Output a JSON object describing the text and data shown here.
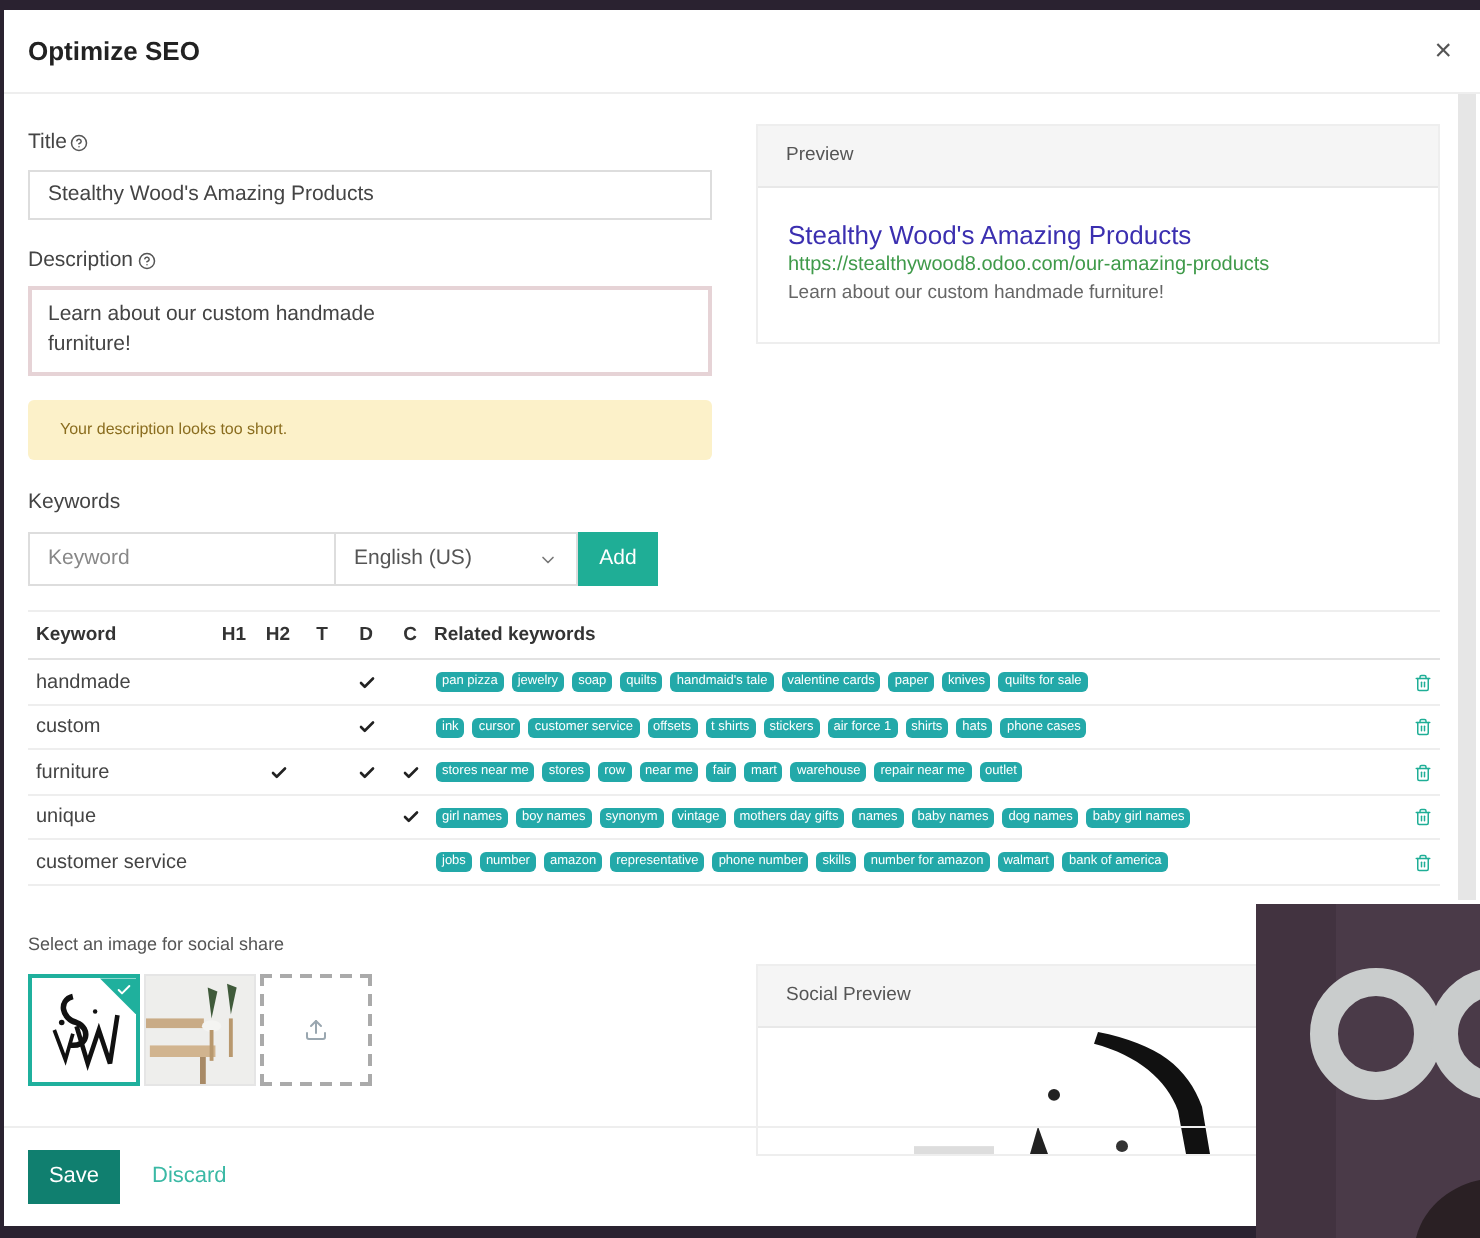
{
  "dialog": {
    "title": "Optimize SEO",
    "close": "×"
  },
  "title_field": {
    "label": "Title",
    "value": "Stealthy Wood's Amazing Products"
  },
  "description_field": {
    "label": "Description",
    "value": "Learn about our custom handmade\nfurniture!"
  },
  "alert": "Your description looks too short.",
  "keywords": {
    "label": "Keywords",
    "placeholder": "Keyword",
    "language": "English (US)",
    "add": "Add"
  },
  "preview": {
    "header": "Preview",
    "title": "Stealthy Wood's Amazing Products",
    "url": "https://stealthywood8.odoo.com/our-amazing-products",
    "description": "Learn about our custom handmade furniture!"
  },
  "table": {
    "columns": [
      "Keyword",
      "H1",
      "H2",
      "T",
      "D",
      "C",
      "Related keywords"
    ],
    "rows": [
      {
        "keyword": "handmade",
        "checks": [
          false,
          false,
          false,
          true,
          false
        ],
        "related": [
          "pan pizza",
          "jewelry",
          "soap",
          "quilts",
          "handmaid's tale",
          "valentine cards",
          "paper",
          "knives",
          "quilts for sale"
        ]
      },
      {
        "keyword": "custom",
        "checks": [
          false,
          false,
          false,
          true,
          false
        ],
        "related": [
          "ink",
          "cursor",
          "customer service",
          "offsets",
          "t shirts",
          "stickers",
          "air force 1",
          "shirts",
          "hats",
          "phone cases"
        ]
      },
      {
        "keyword": "furniture",
        "checks": [
          false,
          true,
          false,
          true,
          true
        ],
        "related": [
          "stores near me",
          "stores",
          "row",
          "near me",
          "fair",
          "mart",
          "warehouse",
          "repair near me",
          "outlet"
        ]
      },
      {
        "keyword": "unique",
        "checks": [
          false,
          false,
          false,
          false,
          true
        ],
        "related": [
          "girl names",
          "boy names",
          "synonym",
          "vintage",
          "mothers day gifts",
          "names",
          "baby names",
          "dog names",
          "baby girl names"
        ]
      },
      {
        "keyword": "customer service",
        "checks": [
          false,
          false,
          false,
          false,
          false
        ],
        "related": [
          "jobs",
          "number",
          "amazon",
          "representative",
          "phone number",
          "skills",
          "number for amazon",
          "walmart",
          "bank of america"
        ]
      }
    ]
  },
  "social": {
    "label": "Select an image for social share",
    "images": [
      {
        "kind": "logo",
        "selected": true
      },
      {
        "kind": "picture",
        "selected": false
      },
      {
        "kind": "upload",
        "selected": false
      }
    ],
    "preview_header": "Social Preview"
  },
  "footer": {
    "save": "Save",
    "discard": "Discard"
  }
}
